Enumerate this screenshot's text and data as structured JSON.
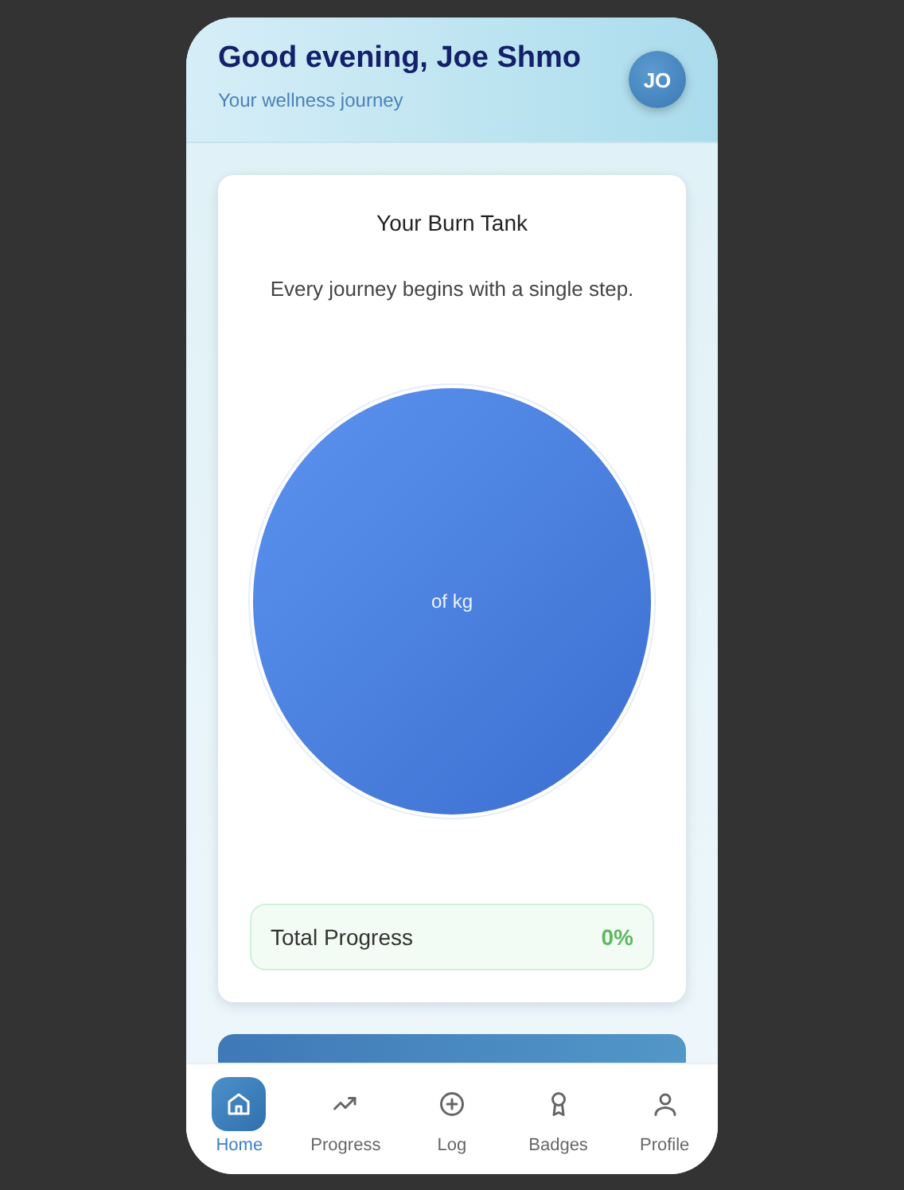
{
  "header": {
    "greeting": "Good evening, Joe Shmo",
    "subtitle": "Your wellness journey",
    "avatar": "JO"
  },
  "burn_tank": {
    "title": "Your Burn Tank",
    "message": "Every journey begins with a single step.",
    "tank_label": "of kg",
    "total_progress": {
      "label": "Total Progress",
      "value": "0%"
    }
  },
  "nav": [
    {
      "label": "Home",
      "kind": "home",
      "selected": true
    },
    {
      "label": "Progress",
      "kind": "trend",
      "selected": false
    },
    {
      "label": "Log",
      "kind": "plus",
      "selected": false
    },
    {
      "label": "Badges",
      "kind": "badge",
      "selected": false
    },
    {
      "label": "Profile",
      "kind": "user",
      "selected": false
    }
  ]
}
